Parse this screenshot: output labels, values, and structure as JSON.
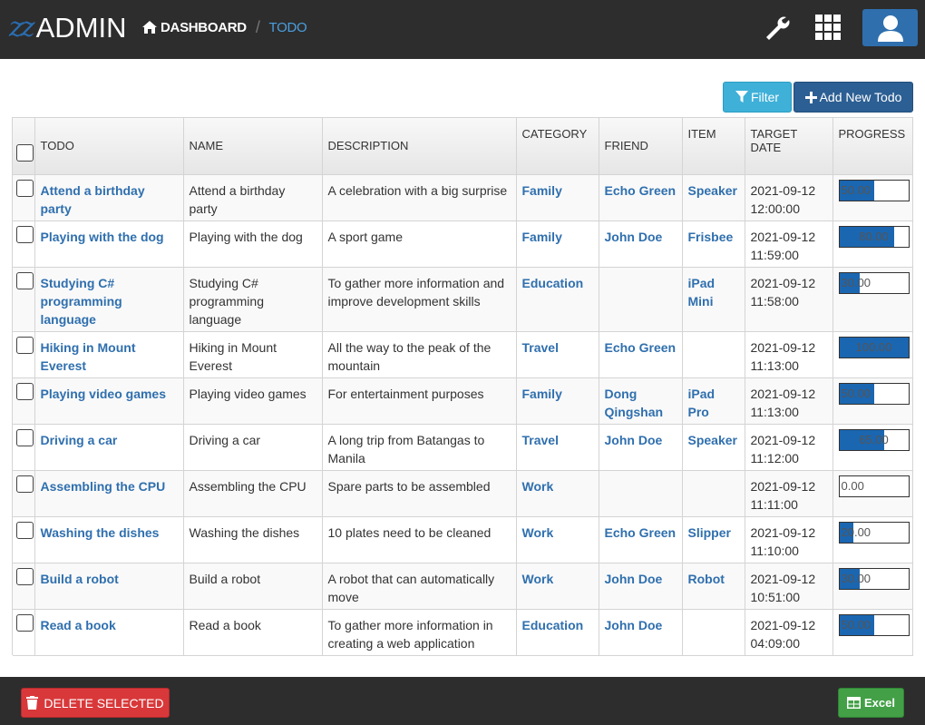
{
  "header": {
    "logo_mark": "zz",
    "logo_text": "ADMIN",
    "breadcrumb_home": "DASHBOARD",
    "breadcrumb_separator": "/",
    "breadcrumb_current": "TODO",
    "icons": [
      "wrench-icon",
      "grid-icon",
      "user-icon"
    ]
  },
  "toolbar": {
    "filter_label": "Filter",
    "add_label": "Add New Todo"
  },
  "table": {
    "columns": [
      "TODO",
      "NAME",
      "DESCRIPTION",
      "CATEGORY",
      "FRIEND",
      "ITEM",
      "TARGET DATE",
      "PROGRESS"
    ],
    "rows": [
      {
        "todo": "Attend a birthday party",
        "name": "Attend a birthday party",
        "description": "A celebration with a big surprise",
        "category": "Family",
        "friend": "Echo Green",
        "item": "Speaker",
        "date": "2021-09-12",
        "time": "12:00:00",
        "progress": 50,
        "progress_label": "50.00"
      },
      {
        "todo": "Playing with the dog",
        "name": "Playing with the dog",
        "description": "A sport game",
        "category": "Family",
        "friend": "John Doe",
        "item": "Frisbee",
        "date": "2021-09-12",
        "time": "11:59:00",
        "progress": 80,
        "progress_label": "80.00"
      },
      {
        "todo": "Studying C# programming language",
        "name": "Studying C# programming language",
        "description": "To gather more information and improve development skills",
        "category": "Education",
        "friend": "",
        "item": "iPad Mini",
        "date": "2021-09-12",
        "time": "11:58:00",
        "progress": 30,
        "progress_label": "30.00"
      },
      {
        "todo": "Hiking in Mount Everest",
        "name": "Hiking in Mount Everest",
        "description": "All the way to the peak of the mountain",
        "category": "Travel",
        "friend": "Echo Green",
        "item": "",
        "date": "2021-09-12",
        "time": "11:13:00",
        "progress": 100,
        "progress_label": "100.00"
      },
      {
        "todo": "Playing video games",
        "name": "Playing video games",
        "description": "For entertainment purposes",
        "category": "Family",
        "friend": "Dong Qingshan",
        "item": "iPad Pro",
        "date": "2021-09-12",
        "time": "11:13:00",
        "progress": 50,
        "progress_label": "50.00"
      },
      {
        "todo": "Driving a car",
        "name": "Driving a car",
        "description": "A long trip from Batangas to Manila",
        "category": "Travel",
        "friend": "John Doe",
        "item": "Speaker",
        "date": "2021-09-12",
        "time": "11:12:00",
        "progress": 65,
        "progress_label": "65.00"
      },
      {
        "todo": "Assembling the CPU",
        "name": "Assembling the CPU",
        "description": "Spare parts to be assembled",
        "category": "Work",
        "friend": "",
        "item": "",
        "date": "2021-09-12",
        "time": "11:11:00",
        "progress": 0,
        "progress_label": "0.00"
      },
      {
        "todo": "Washing the dishes",
        "name": "Washing the dishes",
        "description": "10 plates need to be cleaned",
        "category": "Work",
        "friend": "Echo Green",
        "item": "Slipper",
        "date": "2021-09-12",
        "time": "11:10:00",
        "progress": 20,
        "progress_label": "20.00"
      },
      {
        "todo": "Build a robot",
        "name": "Build a robot",
        "description": "A robot that can automatically move",
        "category": "Work",
        "friend": "John Doe",
        "item": "Robot",
        "date": "2021-09-12",
        "time": "10:51:00",
        "progress": 30,
        "progress_label": "30.00"
      },
      {
        "todo": "Read a book",
        "name": "Read a book",
        "description": "To gather more information in creating a web application",
        "category": "Education",
        "friend": "John Doe",
        "item": "",
        "date": "2021-09-12",
        "time": "04:09:00",
        "progress": 50,
        "progress_label": "50.00"
      }
    ]
  },
  "footer": {
    "delete_label": "DELETE SELECTED",
    "excel_label": "Excel"
  },
  "colors": {
    "topbar": "#2d2d2d",
    "link": "#2f6fae",
    "filter": "#3fb0d8",
    "add": "#2c5f93",
    "delete": "#d9383a",
    "excel": "#43a047",
    "progress_fill": "#1b66b0"
  }
}
